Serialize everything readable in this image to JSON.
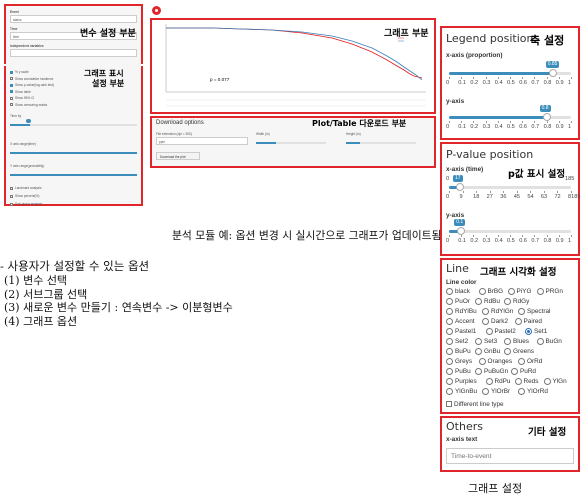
{
  "left_panel": {
    "event_label": "Event",
    "event_value": "status",
    "time_label": "Time",
    "time_value": "time",
    "indep_label": "Independent variables",
    "annotation": "변수 설정 부분",
    "display_annotation_1": "그래프 표시",
    "display_annotation_2": "설정 부분",
    "checkboxes": [
      {
        "label": "% y scale",
        "checked": true
      },
      {
        "label": "Show cumulative incidence",
        "checked": false
      },
      {
        "label": "Show p-value(log-rank test)",
        "checked": true
      },
      {
        "label": "Show table",
        "checked": true
      },
      {
        "label": "Show 95% CI",
        "checked": false
      },
      {
        "label": "Show censoring marks",
        "checked": false
      }
    ],
    "slider1_label": "Time by",
    "slider2_label": "X axis range(time)",
    "slider3_label": "Y axis range(probability)",
    "bottom_checks": [
      {
        "label": "Landmark analysis",
        "checked": false
      },
      {
        "label": "Show percent(%)",
        "checked": false
      },
      {
        "label": "Sub-group analysis",
        "checked": false
      }
    ]
  },
  "graph_panel": {
    "annotation": "그래프 부분",
    "pvalue_text": "p = 0.077",
    "legend_items": [
      "—",
      "—"
    ]
  },
  "download_panel": {
    "title": "Download options",
    "annotation": "Plot/Table 다운로드 부분",
    "file_ext_label": "File extension (dpi = 300)",
    "file_ext_value": "pptx",
    "width_label": "Width (in)",
    "height_label": "Height (in)",
    "download_button": "Download the plot"
  },
  "caption_left": "분석 모듈 예: 옵션 변경 시 실시간으로 그래프가 업데이트됨",
  "notes": {
    "title": "- 사용자가 설정할 수 있는 옵션",
    "items": [
      "(1) 변수 선택",
      "(2) 서브그룹 선택",
      "(3) 새로운 변수 만들기 : 연속변수 -> 이분형변수",
      "(4) 그래프 옵션"
    ]
  },
  "legend_position": {
    "title": "Legend position",
    "annotation": "축 설정",
    "x_label": "x-axis (proportion)",
    "x_value": "0.85",
    "x_ticks": [
      "0",
      "0.1",
      "0.2",
      "0.3",
      "0.4",
      "0.5",
      "0.6",
      "0.7",
      "0.8",
      "0.9",
      "1"
    ],
    "x_fraction": 0.85,
    "y_label": "y-axis",
    "y_value": "0.8",
    "y_ticks": [
      "0",
      "0.1",
      "0.2",
      "0.3",
      "0.4",
      "0.5",
      "0.6",
      "0.7",
      "0.8",
      "0.9",
      "1"
    ],
    "y_fraction": 0.8
  },
  "pvalue_position": {
    "title": "P-value position",
    "annotation": "p값 표시 설정",
    "x_label": "x-axis (time)",
    "x_value": "17",
    "x_max": "185",
    "x_min": "0",
    "x_ticks": [
      "0",
      "9",
      "18",
      "27",
      "36",
      "45",
      "54",
      "63",
      "72",
      "8185"
    ],
    "x_fraction": 0.09,
    "y_label": "y-axis",
    "y_value": "0.1",
    "y_ticks": [
      "0",
      "0.1",
      "0.2",
      "0.3",
      "0.4",
      "0.5",
      "0.6",
      "0.7",
      "0.8",
      "0.9",
      "1"
    ],
    "y_fraction": 0.1
  },
  "line_panel": {
    "title": "Line",
    "annotation": "그래프 시각화 설정",
    "color_label": "Line color",
    "palettes": [
      [
        "black",
        "BrBG",
        "PiYG",
        "PRGn"
      ],
      [
        "PuOr",
        "RdBu",
        "RdGy"
      ],
      [
        "RdYlBu",
        "RdYlGn",
        "Spectral"
      ],
      [
        "Accent",
        "Dark2",
        "Paired"
      ],
      [
        "Pastel1",
        "Pastel2",
        "Set1"
      ],
      [
        "Set2",
        "Set3",
        "Blues",
        "BuGn"
      ],
      [
        "BuPu",
        "GnBu",
        "Greens"
      ],
      [
        "Greys",
        "Oranges",
        "OrRd"
      ],
      [
        "PuBu",
        "PuBuGn",
        "PuRd"
      ],
      [
        "Purples",
        "RdPu",
        "Reds",
        "YlGn"
      ],
      [
        "YlGnBu",
        "YlOrBr",
        "YlOrRd"
      ]
    ],
    "selected": "Set1",
    "different_line_type": "Different line type"
  },
  "others_panel": {
    "title": "Others",
    "annotation": "기타 설정",
    "x_axis_text_label": "x-axis text",
    "x_axis_text_placeholder": "Time-to-event"
  },
  "caption_right": "그래프 설정",
  "colors": {
    "annotation_border": "#e0262b",
    "slider_accent": "#3c8dbc",
    "curve_red": "#e41a1c",
    "curve_blue": "#377eb8"
  }
}
